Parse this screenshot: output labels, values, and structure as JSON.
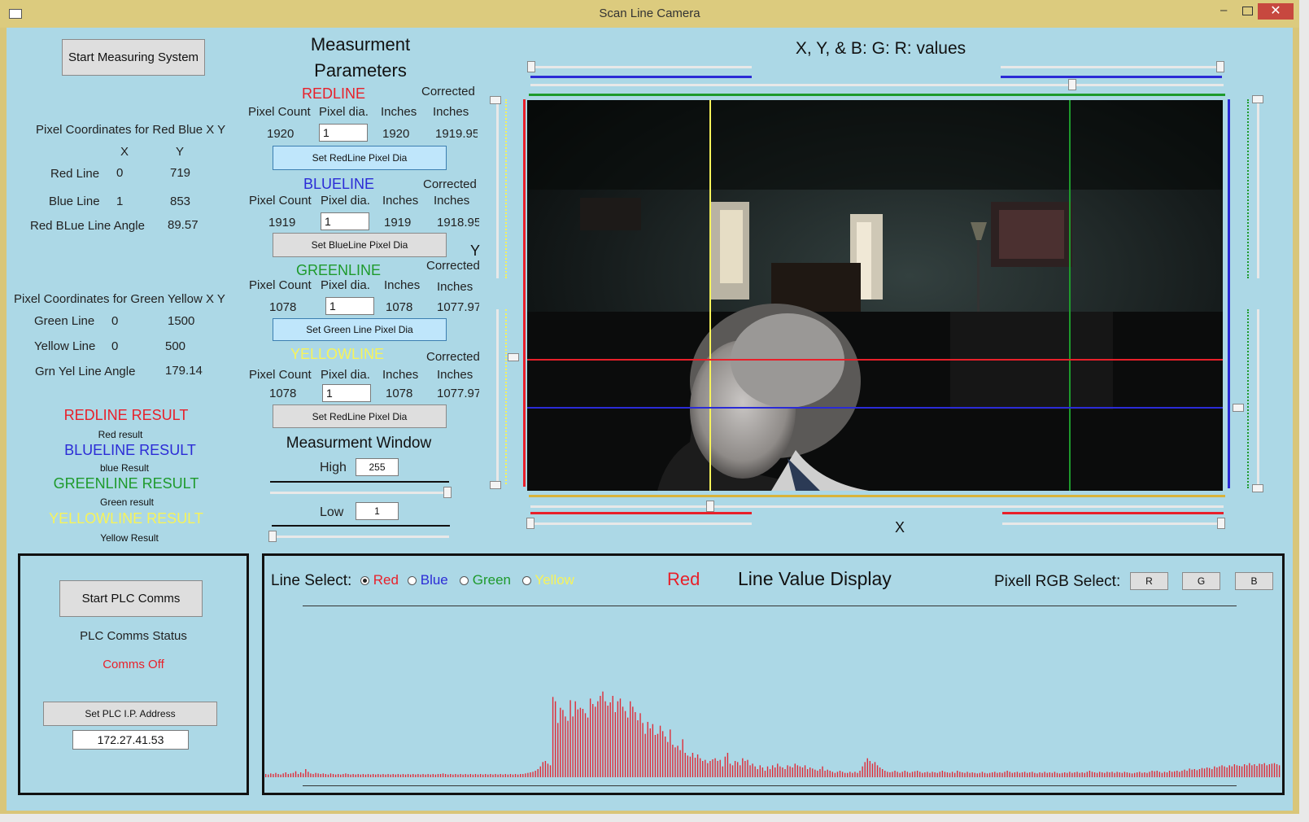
{
  "window": {
    "title": "Scan Line Camera"
  },
  "left": {
    "start_measuring_button": "Start Measuring System",
    "red_blue_heading": "Pixel Coordinates for Red Blue X Y",
    "col_x": "X",
    "col_y": "Y",
    "red_line": {
      "label": "Red Line",
      "x": "0",
      "y": "719"
    },
    "blue_line": {
      "label": "Blue Line",
      "x": "1",
      "y": "853"
    },
    "rb_angle": {
      "label": "Red BLue Line Angle",
      "value": "89.57"
    },
    "green_yellow_heading": "Pixel Coordinates for Green Yellow X Y",
    "green_line": {
      "label": "Green Line",
      "x": "0",
      "y": "1500"
    },
    "yellow_line": {
      "label": "Yellow Line",
      "x": "0",
      "y": "500"
    },
    "gy_angle": {
      "label": "Grn Yel Line Angle",
      "value": "179.14"
    },
    "results": [
      {
        "title": "REDLINE RESULT",
        "value": "Red result"
      },
      {
        "title": "BLUELINE RESULT",
        "value": "blue Result"
      },
      {
        "title": "GREENLINE RESULT",
        "value": "Green result"
      },
      {
        "title": "YELLOWLINE RESULT",
        "value": "Yellow Result"
      }
    ]
  },
  "params": {
    "title_line1": "Measurment",
    "title_line2": "Parameters",
    "col_pixel_count": "Pixel Count",
    "col_pixel_dia": "Pixel dia.",
    "col_inches": "Inches",
    "col_corrected": "Corrected",
    "col_corrected_inches": "Inches",
    "redline": {
      "name": "REDLINE",
      "count": "1920",
      "dia": "1",
      "inches": "1920",
      "corrected": "1919.95",
      "button": "Set RedLine Pixel Dia"
    },
    "blueline": {
      "name": "BLUELINE",
      "count": "1919",
      "dia": "1",
      "inches": "1919",
      "corrected": "1918.95",
      "button": "Set BlueLine Pixel Dia"
    },
    "greenline": {
      "name": "GREENLINE",
      "count": "1078",
      "dia": "1",
      "inches": "1078",
      "corrected": "1077.97",
      "button": "Set Green Line Pixel Dia"
    },
    "yellowline": {
      "name": "YELLOWLINE",
      "count": "1078",
      "dia": "1",
      "inches": "1078",
      "corrected": "1077.97",
      "button": "Set RedLine Pixel Dia"
    },
    "window_title": "Measurment Window",
    "high_label": "High",
    "high_value": "255",
    "low_label": "Low",
    "low_value": "1"
  },
  "camera": {
    "heading": "X, Y, & B: G: R: values",
    "y_axis_label": "Y",
    "x_axis_label": "X"
  },
  "plc": {
    "start_button": "Start PLC Comms",
    "status_label": "PLC Comms Status",
    "status_value": "Comms Off",
    "set_ip_button": "Set PLC I.P. Address",
    "ip_value": "172.27.41.53"
  },
  "display": {
    "line_select_label": "Line Select:",
    "options": [
      "Red",
      "Blue",
      "Green",
      "Yellow"
    ],
    "selected_option": "Red",
    "current_line": "Red",
    "title": "Line Value Display",
    "rgb_label": "Pixell RGB Select:",
    "rgb_buttons": [
      "R",
      "G",
      "B"
    ]
  },
  "colors": {
    "red": "#e8202a",
    "blue": "#2b2bd6",
    "green": "#1e9a2c",
    "yellow": "#f7f35a",
    "panel_bg": "#acd8e6",
    "histogram_bar": "#e02a36"
  },
  "icons": [
    "app-icon",
    "minimize-icon",
    "maximize-icon",
    "close-icon"
  ],
  "chart_data": {
    "type": "bar",
    "series_color": "#e02a36",
    "ylim": [
      0,
      255
    ],
    "values": [
      6,
      5,
      7,
      6,
      8,
      6,
      5,
      7,
      9,
      6,
      7,
      8,
      11,
      6,
      9,
      7,
      15,
      10,
      7,
      6,
      8,
      7,
      6,
      7,
      6,
      5,
      7,
      6,
      5,
      6,
      5,
      6,
      7,
      6,
      5,
      6,
      5,
      6,
      5,
      6,
      5,
      6,
      5,
      6,
      5,
      6,
      5,
      6,
      5,
      6,
      5,
      6,
      5,
      6,
      5,
      6,
      5,
      6,
      5,
      6,
      5,
      6,
      5,
      6,
      5,
      6,
      5,
      6,
      5,
      6,
      6,
      7,
      6,
      5,
      6,
      5,
      6,
      5,
      6,
      5,
      6,
      5,
      6,
      5,
      6,
      5,
      6,
      5,
      6,
      5,
      6,
      5,
      6,
      5,
      6,
      5,
      6,
      5,
      6,
      5,
      6,
      5,
      6,
      6,
      7,
      8,
      9,
      10,
      12,
      15,
      20,
      28,
      30,
      25,
      22,
      148,
      140,
      100,
      128,
      124,
      112,
      104,
      142,
      112,
      140,
      125,
      128,
      126,
      118,
      110,
      145,
      135,
      130,
      140,
      150,
      158,
      140,
      132,
      138,
      150,
      120,
      140,
      145,
      130,
      122,
      110,
      140,
      130,
      120,
      105,
      118,
      100,
      80,
      102,
      90,
      98,
      78,
      80,
      95,
      85,
      75,
      65,
      88,
      60,
      55,
      58,
      50,
      70,
      45,
      40,
      38,
      45,
      36,
      42,
      35,
      30,
      32,
      26,
      30,
      33,
      35,
      30,
      32,
      20,
      38,
      45,
      25,
      22,
      30,
      28,
      22,
      35,
      30,
      32,
      22,
      25,
      20,
      15,
      22,
      18,
      12,
      20,
      15,
      22,
      18,
      25,
      20,
      18,
      15,
      22,
      20,
      18,
      25,
      22,
      20,
      18,
      22,
      15,
      18,
      16,
      14,
      12,
      15,
      20,
      12,
      14,
      12,
      10,
      8,
      10,
      12,
      10,
      8,
      8,
      10,
      8,
      10,
      8,
      12,
      20,
      28,
      35,
      30,
      25,
      28,
      22,
      18,
      15,
      12,
      10,
      9,
      10,
      12,
      10,
      8,
      10,
      12,
      10,
      8,
      10,
      11,
      12,
      10,
      8,
      9,
      10,
      8,
      10,
      9,
      8,
      10,
      12,
      10,
      9,
      8,
      10,
      8,
      12,
      10,
      9,
      8,
      10,
      8,
      9,
      8,
      7,
      8,
      10,
      8,
      7,
      8,
      9,
      10,
      8,
      9,
      8,
      10,
      12,
      10,
      8,
      9,
      10,
      8,
      9,
      10,
      8,
      9,
      10,
      8,
      7,
      9,
      8,
      10,
      8,
      9,
      8,
      10,
      8,
      7,
      8,
      9,
      8,
      10,
      8,
      9,
      10,
      8,
      9,
      8,
      10,
      12,
      10,
      9,
      8,
      10,
      9,
      8,
      10,
      9,
      10,
      8,
      10,
      9,
      8,
      10,
      9,
      8,
      7,
      8,
      9,
      10,
      8,
      9,
      8,
      10,
      12,
      11,
      12,
      10,
      8,
      10,
      9,
      12,
      10,
      11,
      12,
      10,
      12,
      14,
      12,
      16,
      14,
      15,
      13,
      15,
      17,
      16,
      18,
      17,
      15,
      20,
      18,
      20,
      22,
      20,
      18,
      22,
      20,
      24,
      22,
      21,
      20,
      24,
      22,
      26,
      22,
      24,
      21,
      25,
      24,
      26,
      22,
      24,
      25,
      26,
      24,
      22
    ]
  }
}
